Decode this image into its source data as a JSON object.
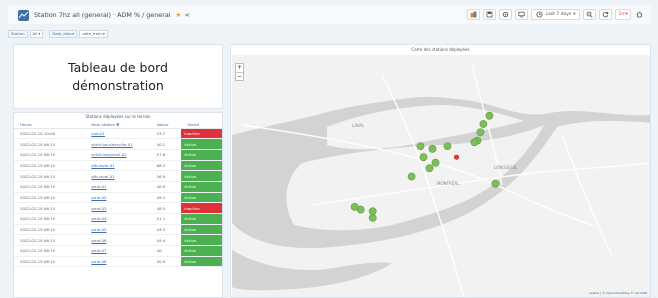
{
  "header": {
    "title": "Station 7hz all (general) · ADM % / general",
    "time_range": "Last 7 days",
    "refresh_label": "1m"
  },
  "variables": [
    {
      "label": "Station",
      "value": "All"
    },
    {
      "label": "Date_debut",
      "value": "date_from"
    }
  ],
  "text_panel": {
    "heading": "Tableau de bord démonstration"
  },
  "table_panel": {
    "title": "Stations déployées sur le terrain",
    "columns": [
      "Heure",
      "Nom station ▼",
      "Valeur",
      "Statut"
    ],
    "rows": [
      {
        "time": "2022-02-10 10:00",
        "station": "pxb-01",
        "value": "53.7",
        "status": "Inactive"
      },
      {
        "time": "2022-02-19 06:15",
        "station": "sirb9-boucherville-01",
        "value": "40.1",
        "status": "Active"
      },
      {
        "time": "2022-02-19 06:15",
        "station": "sirb9-longueuil-01",
        "value": "57.6",
        "status": "Active"
      },
      {
        "time": "2022-02-19 06:15",
        "station": "pfb-laval-01",
        "value": "66.2",
        "status": "Active"
      },
      {
        "time": "2022-02-19 06:15",
        "station": "pfb-laval-01",
        "value": "56.9",
        "status": "Active"
      },
      {
        "time": "2022-02-19 06:15",
        "station": "pmb-01",
        "value": "40.9",
        "status": "Active"
      },
      {
        "time": "2022-02-19 06:15",
        "station": "pmb-02",
        "value": "49.1",
        "status": "Active"
      },
      {
        "time": "2022-02-19 06:15",
        "station": "pmb-03",
        "value": "48.5",
        "status": "Inactive"
      },
      {
        "time": "2022-02-19 06:15",
        "station": "pmb-04",
        "value": "51.1",
        "status": "Active"
      },
      {
        "time": "2022-02-19 06:15",
        "station": "pmb-05",
        "value": "44.5",
        "status": "Active"
      },
      {
        "time": "2022-02-19 06:15",
        "station": "pmb-06",
        "value": "49.4",
        "status": "Active"
      },
      {
        "time": "2022-02-19 06:15",
        "station": "pmb-07",
        "value": "40",
        "status": "Active"
      },
      {
        "time": "2022-02-19 06:15",
        "station": "pmb-08",
        "value": "50.9",
        "status": "Active"
      }
    ]
  },
  "map_panel": {
    "title": "Carte des stations déployées",
    "zoom_in": "+",
    "zoom_out": "−",
    "attribution": "Leaflet | © OpenStreetMap © CartoDB",
    "place_labels": [
      "LAVAL",
      "MONTRÉAL",
      "LONGUEUIL"
    ],
    "stations": [
      {
        "status": "Active",
        "lon": -73.55,
        "lat": 45.62
      },
      {
        "status": "Active",
        "lon": -73.56,
        "lat": 45.605
      },
      {
        "status": "Active",
        "lon": -73.565,
        "lat": 45.59
      },
      {
        "status": "Active",
        "lon": -73.57,
        "lat": 45.575
      },
      {
        "status": "Active",
        "lon": -73.575,
        "lat": 45.572
      },
      {
        "status": "Active",
        "lon": -73.62,
        "lat": 45.565
      },
      {
        "status": "Active",
        "lon": -73.645,
        "lat": 45.56
      },
      {
        "status": "Active",
        "lon": -73.665,
        "lat": 45.565
      },
      {
        "status": "Active",
        "lon": -73.66,
        "lat": 45.545
      },
      {
        "status": "Active",
        "lon": -73.64,
        "lat": 45.535
      },
      {
        "status": "Active",
        "lon": -73.65,
        "lat": 45.525
      },
      {
        "status": "Inactive",
        "lon": -73.605,
        "lat": 45.545
      },
      {
        "status": "Active",
        "lon": -73.68,
        "lat": 45.51
      },
      {
        "status": "Active",
        "lon": -73.54,
        "lat": 45.497
      },
      {
        "status": "Active",
        "lon": -73.775,
        "lat": 45.455
      },
      {
        "status": "Active",
        "lon": -73.765,
        "lat": 45.45
      },
      {
        "status": "Active",
        "lon": -73.745,
        "lat": 45.447
      },
      {
        "status": "Active",
        "lon": -73.745,
        "lat": 45.435
      }
    ]
  },
  "colors": {
    "active": "#4caf50",
    "inactive": "#e0303a",
    "marker_active": "#7cbf5a",
    "marker_inactive": "#e03a3a",
    "water": "#d3d3d3",
    "land": "#f2f2f2",
    "roads": "#ffffff"
  },
  "icons": [
    "grafana-logo-icon",
    "star-icon",
    "share-icon",
    "add-panel-icon",
    "save-icon",
    "settings-icon",
    "tv-icon",
    "clock-icon",
    "zoom-out-icon",
    "refresh-icon",
    "chevron-down-icon"
  ]
}
